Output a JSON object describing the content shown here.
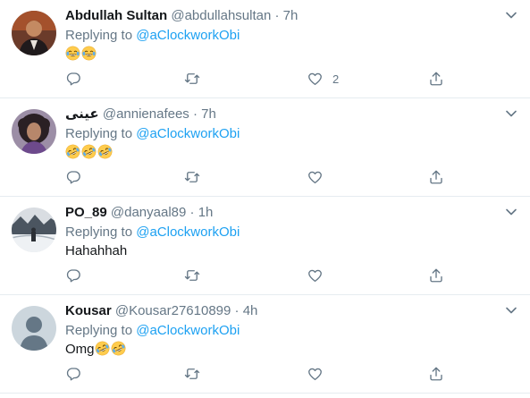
{
  "tweets": [
    {
      "name": "Abdullah Sultan",
      "handle": "@abdullahsultan",
      "separator": "·",
      "time": "7h",
      "replying_prefix": "Replying to ",
      "replying_to": "@aClockworkObi",
      "text": "",
      "emoji": [
        "😂",
        "😂"
      ],
      "like_count": "2",
      "avatar_icon": "man-in-suit-avatar"
    },
    {
      "name": "عينى",
      "handle": "@annienafees",
      "separator": "·",
      "time": "7h",
      "replying_prefix": "Replying to ",
      "replying_to": "@aClockworkObi",
      "text": "",
      "emoji": [
        "🤣",
        "🤣",
        "🤣"
      ],
      "like_count": "",
      "avatar_icon": "woman-curly-hair-avatar"
    },
    {
      "name": "PO_89",
      "handle": "@danyaal89",
      "separator": "·",
      "time": "1h",
      "replying_prefix": "Replying to ",
      "replying_to": "@aClockworkObi",
      "text": "Hahahhah",
      "emoji": [],
      "like_count": "",
      "avatar_icon": "snowy-landscape-avatar"
    },
    {
      "name": "Kousar",
      "handle": "@Kousar27610899",
      "separator": "·",
      "time": "4h",
      "replying_prefix": "Replying to ",
      "replying_to": "@aClockworkObi",
      "text": "Omg",
      "emoji": [
        "🤣",
        "🤣"
      ],
      "like_count": "",
      "avatar_icon": "default-profile-avatar"
    }
  ],
  "icons": {
    "reply": "reply-icon",
    "retweet": "retweet-icon",
    "like": "heart-icon",
    "share": "share-icon",
    "menu": "chevron-down-icon"
  },
  "colors": {
    "link": "#1da1f2",
    "secondary_text": "#657786",
    "primary_text": "#14171a",
    "divider": "#e6ecf0"
  }
}
